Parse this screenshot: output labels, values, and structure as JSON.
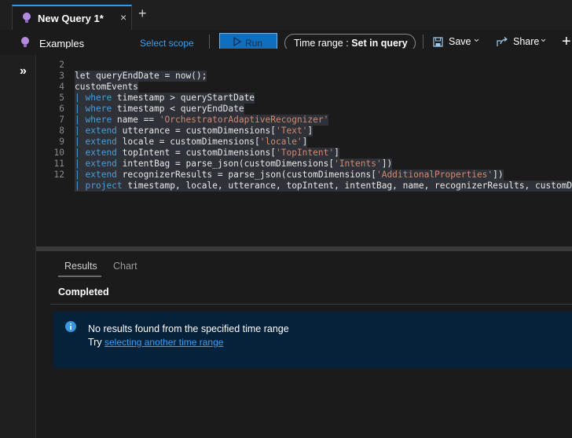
{
  "tab": {
    "title": "New Query 1*",
    "close_icon": "×",
    "new_tab_icon": "+"
  },
  "toolbar": {
    "examples_label": "Examples",
    "select_scope_label": "Select scope",
    "run_label": "Run",
    "time_range_label": "Time range :",
    "time_range_value": "Set in query",
    "save_label": "Save",
    "share_label": "Share",
    "add_icon": "+",
    "chevron": "⌄"
  },
  "sidebar": {
    "expand_icon": "»"
  },
  "editor": {
    "lines": [
      {
        "num": "2",
        "text": "let queryEndDate = now();"
      },
      {
        "num": "3",
        "text": "customEvents"
      },
      {
        "num": "4",
        "text": "| where timestamp > queryStartDate"
      },
      {
        "num": "5",
        "text": "| where timestamp < queryEndDate"
      },
      {
        "num": "6",
        "text": "| where name == 'OrchestratorAdaptiveRecognizer'"
      },
      {
        "num": "7",
        "text": "| extend utterance = customDimensions['Text']"
      },
      {
        "num": "8",
        "text": "| extend locale = customDimensions['locale']"
      },
      {
        "num": "9",
        "text": "| extend topIntent = customDimensions['TopIntent']"
      },
      {
        "num": "10",
        "text": "| extend intentBag = parse_json(customDimensions['Intents'])"
      },
      {
        "num": "11",
        "text": "| extend recognizerResults = parse_json(customDimensions['AdditionalProperties'])"
      },
      {
        "num": "12",
        "text": "| project timestamp, locale, utterance, topIntent, intentBag, name, recognizerResults, customDimensions"
      }
    ]
  },
  "results": {
    "tabs": [
      "Results",
      "Chart"
    ],
    "status": "Completed",
    "message": "No results found from the specified time range",
    "try_label": "Try",
    "link_text": "selecting another time range"
  },
  "colors": {
    "accent": "#3a96dd",
    "run_button": "#106ebe",
    "link": "#3aa0f3",
    "keyword": "#4a9cd6",
    "string": "#d08a70",
    "info_background": "#06213a"
  }
}
